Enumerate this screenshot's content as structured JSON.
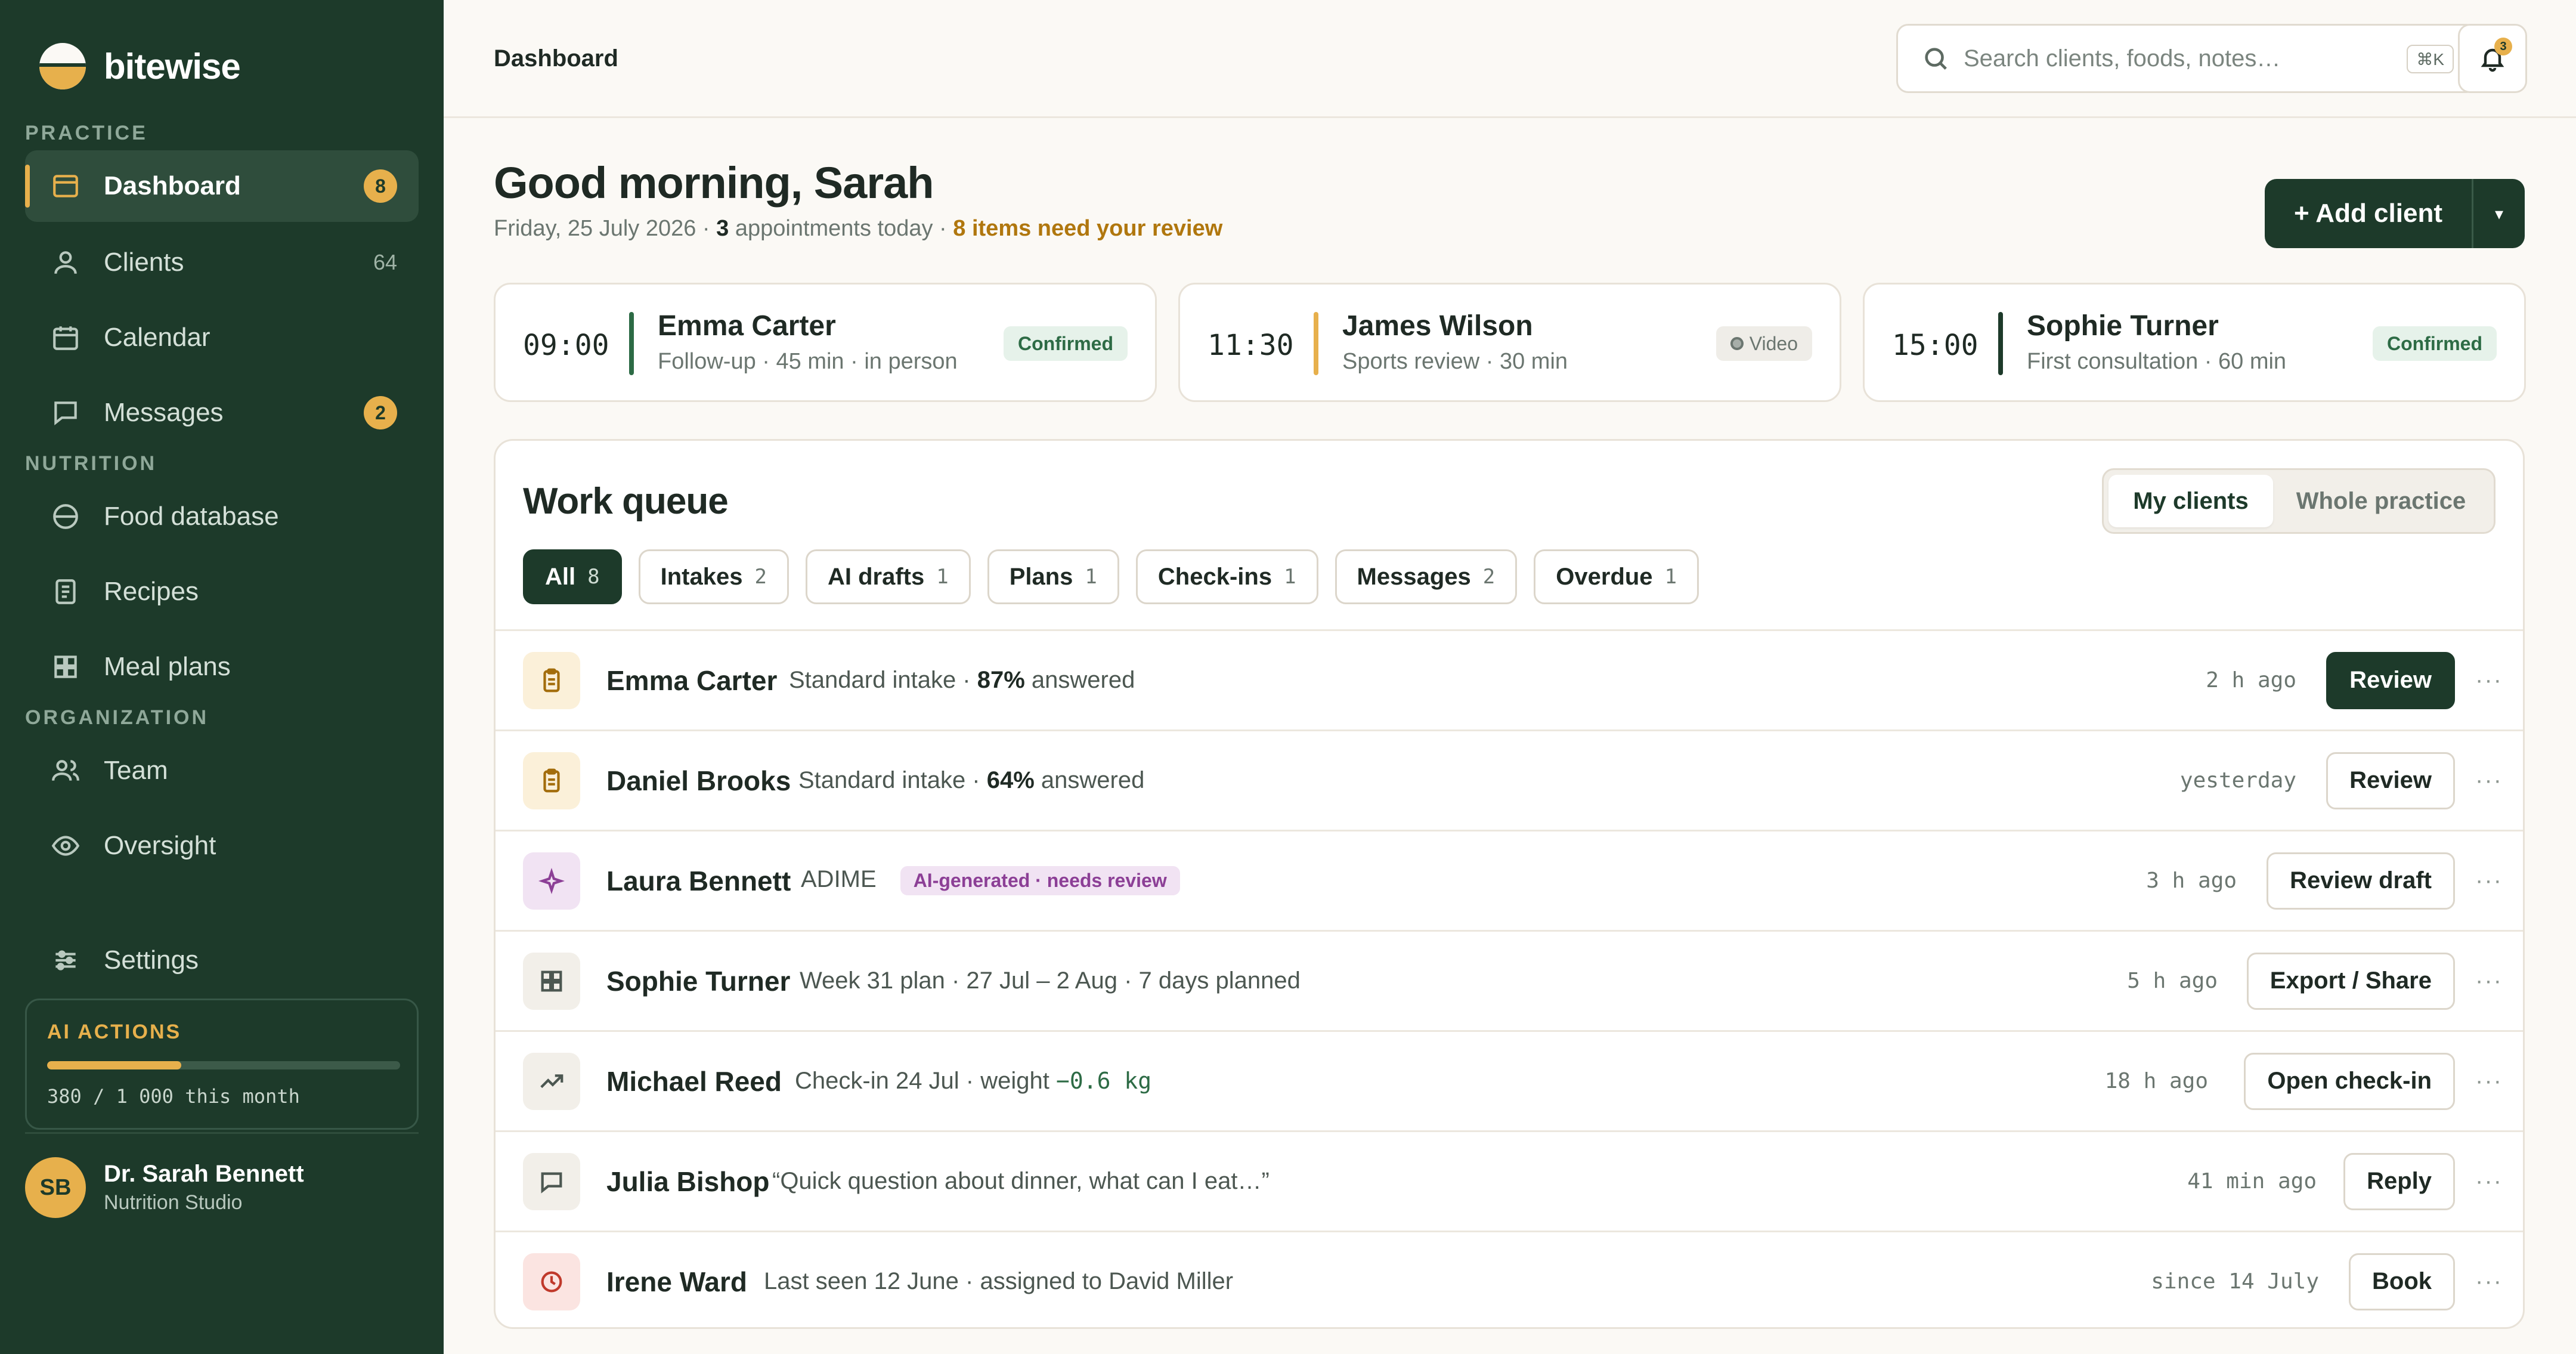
{
  "app": {
    "name": "bitewise"
  },
  "sidebar": {
    "sections": {
      "practice": "PRACTICE",
      "nutrition": "NUTRITION",
      "organization": "ORGANIZATION"
    },
    "items": [
      {
        "label": "Dashboard",
        "icon": "dashboard-icon",
        "badge": "8",
        "active": true
      },
      {
        "label": "Clients",
        "icon": "user-icon",
        "count": "64"
      },
      {
        "label": "Calendar",
        "icon": "calendar-icon"
      },
      {
        "label": "Messages",
        "icon": "message-icon",
        "badge": "2"
      },
      {
        "label": "Food database",
        "icon": "food-icon"
      },
      {
        "label": "Recipes",
        "icon": "recipe-icon"
      },
      {
        "label": "Meal plans",
        "icon": "grid-icon"
      },
      {
        "label": "Team",
        "icon": "team-icon"
      },
      {
        "label": "Oversight",
        "icon": "eye-icon"
      },
      {
        "label": "Settings",
        "icon": "sliders-icon"
      }
    ],
    "ai_actions": {
      "title": "AI ACTIONS",
      "used": 380,
      "limit": 1000,
      "usage_text": "380 / 1 000 this month",
      "accent": "#e7b04c"
    },
    "user": {
      "initials": "SB",
      "name": "Dr. Sarah Bennett",
      "org": "Nutrition Studio"
    }
  },
  "header": {
    "breadcrumb": "Dashboard",
    "search": {
      "placeholder": "Search clients, foods, notes…",
      "shortcut": "⌘K"
    },
    "notifications": {
      "count": "3"
    }
  },
  "greeting": {
    "title": "Good morning, Sarah",
    "date": "Friday, 25 July 2026 · ",
    "appointments": "3",
    "appointments_suffix": " appointments today · ",
    "review": "8 items need your review"
  },
  "add_client": {
    "label": "+ Add client",
    "caret": "▾"
  },
  "appointments": [
    {
      "time": "09:00",
      "name": "Emma Carter",
      "detail": "Follow-up · 45 min · in person",
      "tag": "Confirmed",
      "bar_color": "#2d6b45"
    },
    {
      "time": "11:30",
      "name": "James Wilson",
      "detail": "Sports review · 30 min",
      "tag": "Video",
      "bar_color": "#e7b04c"
    },
    {
      "time": "15:00",
      "name": "Sophie Turner",
      "detail": "First consultation · 60 min",
      "tag": "Confirmed",
      "bar_color": "#1d3a2a"
    }
  ],
  "queue": {
    "title": "Work queue",
    "segments": [
      "My clients",
      "Whole practice"
    ],
    "chips": [
      {
        "label": "All",
        "count": "8"
      },
      {
        "label": "Intakes",
        "count": "2"
      },
      {
        "label": "AI drafts",
        "count": "1"
      },
      {
        "label": "Plans",
        "count": "1"
      },
      {
        "label": "Check-ins",
        "count": "1"
      },
      {
        "label": "Messages",
        "count": "2"
      },
      {
        "label": "Overdue",
        "count": "1"
      }
    ],
    "rows": [
      {
        "name": "Emma Carter",
        "desc_pre": "Standard intake · ",
        "desc_bold": "87%",
        "desc_post": " answered",
        "time": "2 h ago",
        "action": "Review",
        "icon": "clipboard-icon"
      },
      {
        "name": "Daniel Brooks",
        "desc_pre": "Standard intake · ",
        "desc_bold": "64%",
        "desc_post": " answered",
        "time": "yesterday",
        "action": "Review",
        "icon": "clipboard-icon"
      },
      {
        "name": "Laura Bennett",
        "desc": "ADIME",
        "pill": "AI-generated · needs review",
        "time": "3 h ago",
        "action": "Review draft",
        "icon": "sparkle-icon"
      },
      {
        "name": "Sophie Turner",
        "desc": "Week 31 plan · 27 Jul – 2 Aug · 7 days planned",
        "time": "5 h ago",
        "action": "Export / Share",
        "icon": "grid-icon"
      },
      {
        "name": "Michael Reed",
        "desc_pre": "Check-in 24 Jul · weight ",
        "delta": "−0.6 kg",
        "time": "18 h ago",
        "action": "Open check-in",
        "icon": "trend-icon"
      },
      {
        "name": "Julia Bishop",
        "desc": "“Quick question about dinner, what can I eat…”",
        "time": "41 min ago",
        "action": "Reply",
        "icon": "message-icon"
      },
      {
        "name": "Irene Ward",
        "desc": "Last seen 12 June · assigned to David Miller",
        "time": "since 14 July",
        "action": "Book",
        "icon": "clock-icon"
      }
    ],
    "more": "···"
  }
}
